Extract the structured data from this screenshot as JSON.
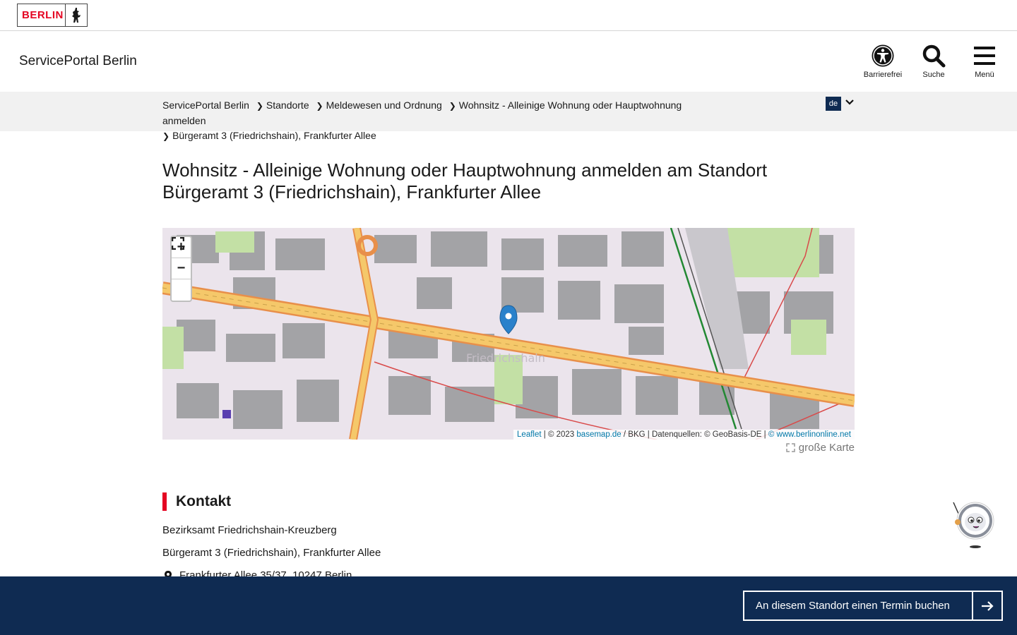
{
  "logo": {
    "text": "BERLIN"
  },
  "header": {
    "site_title": "ServicePortal Berlin",
    "tools": [
      {
        "label": "Barrierefrei",
        "icon": "accessibility-icon"
      },
      {
        "label": "Suche",
        "icon": "search-icon"
      },
      {
        "label": "Menü",
        "icon": "menu-icon"
      }
    ]
  },
  "breadcrumb": {
    "items": [
      "ServicePortal Berlin",
      "Standorte",
      "Meldewesen und Ordnung",
      "Wohnsitz - Alleinige Wohnung oder Hauptwohnung anmelden",
      "Bürgeramt 3 (Friedrichshain), Frankfurter Allee"
    ],
    "language": "de"
  },
  "main": {
    "title": "Wohnsitz - Alleinige Wohnung oder Hauptwohnung anmelden am Standort Bürgeramt 3 (Friedrichshain), Frankfurter Allee",
    "map": {
      "zoom_in": "+",
      "zoom_out": "−",
      "attribution": {
        "leaflet": "Leaflet",
        "copyright": "| © 2023",
        "basemap": "basemap.de",
        "rest": "/ BKG | Datenquellen: © GeoBasis-DE |",
        "berlinonline": "© www.berlinonline.net"
      },
      "big_map_label": "große Karte"
    },
    "contact": {
      "title": "Kontakt",
      "authority": "Bezirksamt Friedrichshain-Kreuzberg",
      "office": "Bürgeramt 3 (Friedrichshain), Frankfurter Allee",
      "address": "Frankfurter Allee 35/37, 10247 Berlin"
    }
  },
  "booking": {
    "label": "An diesem Standort einen Termin buchen"
  },
  "colors": {
    "brand_red": "#e40422",
    "navy": "#0f2b52",
    "link": "#0078a8"
  }
}
